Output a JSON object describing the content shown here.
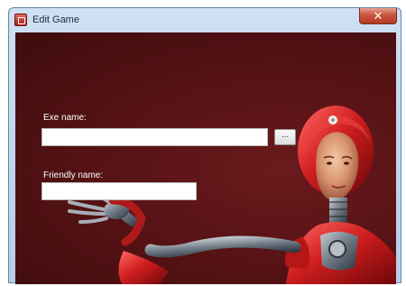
{
  "window": {
    "title": "Edit Game",
    "close_glyph": "✕"
  },
  "form": {
    "exe_label": "Exe name:",
    "exe_value": "",
    "browse_label": "...",
    "friendly_label": "Friendly name:",
    "friendly_value": ""
  },
  "icons": [
    "app-icon",
    "close-icon"
  ]
}
